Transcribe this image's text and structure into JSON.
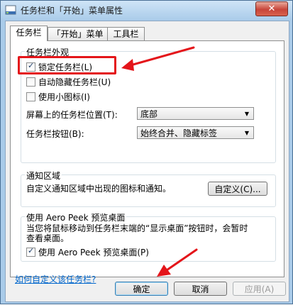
{
  "window": {
    "title": "任务栏和「开始」菜单属性",
    "close_label": "✕"
  },
  "tabs": [
    {
      "label": "任务栏",
      "active": true
    },
    {
      "label": "「开始」菜单",
      "active": false
    },
    {
      "label": "工具栏",
      "active": false
    }
  ],
  "appearance": {
    "group_label": "任务栏外观",
    "lock_taskbar": {
      "label": "锁定任务栏(L)",
      "checked": true
    },
    "auto_hide": {
      "label": "自动隐藏任务栏(U)",
      "checked": false
    },
    "small_icons": {
      "label": "使用小图标(I)",
      "checked": false
    },
    "location": {
      "label": "屏幕上的任务栏位置(T):",
      "value": "底部"
    },
    "buttons": {
      "label": "任务栏按钮(B):",
      "value": "始终合并、隐藏标签"
    }
  },
  "notification": {
    "group_label": "通知区域",
    "description": "自定义通知区域中出现的图标和通知。",
    "customize_label": "自定义(C)..."
  },
  "aero_peek": {
    "group_label": "使用 Aero Peek 预览桌面",
    "description_line1": "当您将鼠标移动到任务栏末端的“显示桌面”按钮时，会暂时",
    "description_line2": "查看桌面。",
    "checkbox": {
      "label": "使用 Aero Peek 预览桌面(P)",
      "checked": true
    }
  },
  "help_link": "如何自定义该任务栏?",
  "footer": {
    "ok_label": "确定",
    "cancel_label": "取消",
    "apply_label": "应用(A)"
  },
  "annotation_color": "#e4151a"
}
